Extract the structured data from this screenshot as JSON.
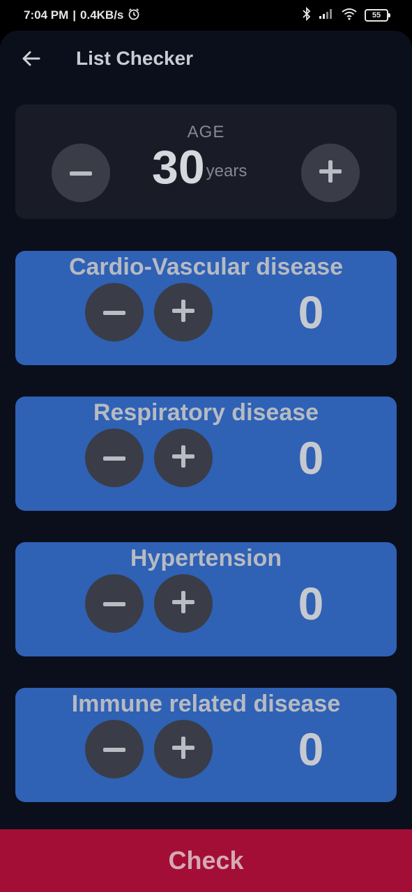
{
  "status_bar": {
    "time": "7:04 PM",
    "speed": "0.4KB/s",
    "battery": "55",
    "icons": [
      "alarm-icon",
      "bluetooth-icon",
      "signal-icon",
      "wifi-icon",
      "battery-icon"
    ]
  },
  "app_bar": {
    "title": "List Checker",
    "back_icon": "arrow-left-icon"
  },
  "age": {
    "label": "AGE",
    "value": "30",
    "unit": "years"
  },
  "diseases": [
    {
      "title": "Cardio-Vascular disease",
      "count": "0"
    },
    {
      "title": "Respiratory disease",
      "count": "0"
    },
    {
      "title": "Hypertension",
      "count": "0"
    },
    {
      "title": "Immune related disease",
      "count": "0"
    }
  ],
  "footer": {
    "check_label": "Check"
  },
  "colors": {
    "background": "#0b0f1c",
    "age_card": "#191c27",
    "disease_card": "#2f61b5",
    "round_button": "#3a3d47",
    "check_button": "#a30e37"
  }
}
